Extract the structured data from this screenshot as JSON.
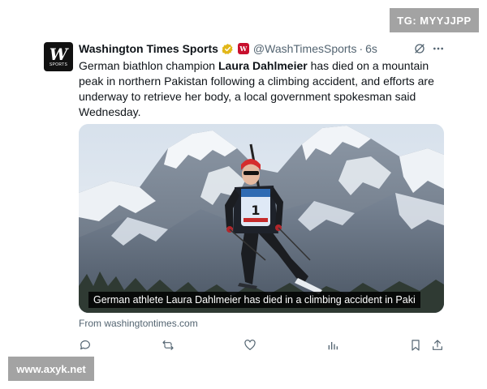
{
  "overlay": {
    "top_right_badge": "TG: MYYJJPP",
    "bottom_left_badge": "www.axyk.net"
  },
  "tweet": {
    "avatar_monogram": "W",
    "avatar_sub": "SPORTS",
    "author_name": "Washington Times Sports",
    "handle": "@WashTimesSports",
    "separator": "·",
    "time": "6s",
    "text_before": "German biathlon champion ",
    "text_bold": "Laura Dahlmeier",
    "text_after": " has died on a mountain peak in northern Pakistan following a climbing accident, and efforts are underway to retrieve her body, a local government spokesman said Wednesday.",
    "media_caption": "German athlete Laura Dahlmeier has died in a climbing accident in Paki",
    "bib_number": "1",
    "source_link": "From washingtontimes.com"
  },
  "icons": {
    "verified": "verified-gold-badge-icon",
    "org": "org-affiliate-badge-icon",
    "grok": "grok-icon",
    "more": "more-dots-icon",
    "reply": "reply-icon",
    "retweet": "retweet-icon",
    "like": "heart-icon",
    "views": "views-chart-icon",
    "bookmark": "bookmark-icon",
    "share": "share-icon"
  },
  "colors": {
    "verified_gold": "#e2b719",
    "org_badge": "#c8102e",
    "text_primary": "#0f1419",
    "text_secondary": "#536471",
    "watermark_bg": "#a3a3a3"
  }
}
